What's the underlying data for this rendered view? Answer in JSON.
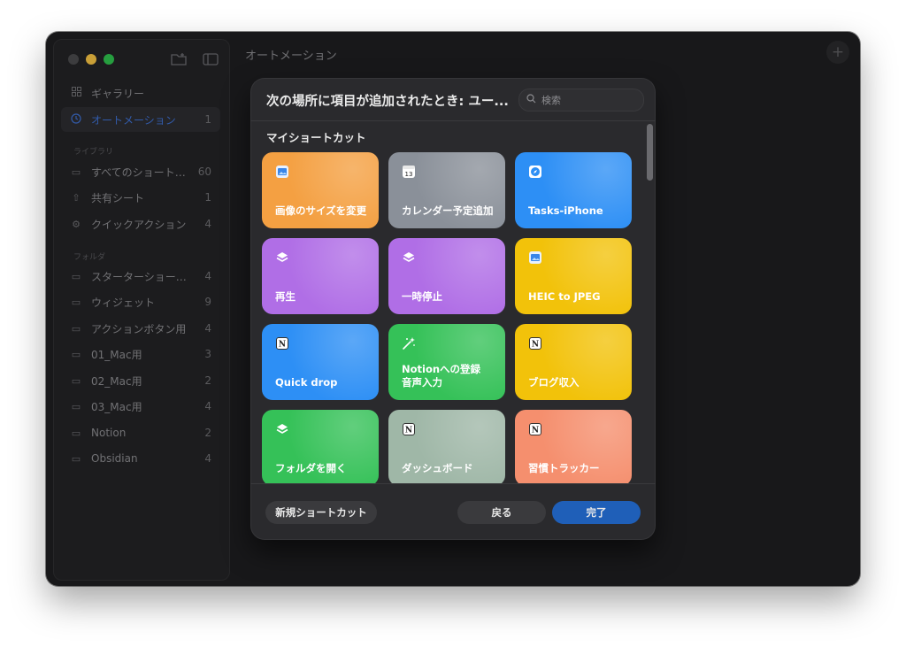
{
  "window": {
    "title": "オートメーション"
  },
  "sidebar": {
    "top_items": [
      {
        "icon": "grid-icon",
        "label": "ギャラリー",
        "count": ""
      },
      {
        "icon": "clock-icon",
        "label": "オートメーション",
        "count": "1"
      }
    ],
    "library_label": "ライブラリ",
    "library_items": [
      {
        "icon": "stack-icon",
        "label": "すべてのショートカ…",
        "count": "60"
      },
      {
        "icon": "share-icon",
        "label": "共有シート",
        "count": "1"
      },
      {
        "icon": "gear-icon",
        "label": "クイックアクション",
        "count": "4"
      }
    ],
    "folders_label": "フォルダ",
    "folder_items": [
      {
        "label": "スターターショートカ…",
        "count": "4"
      },
      {
        "label": "ウィジェット",
        "count": "9"
      },
      {
        "label": "アクションボタン用",
        "count": "4"
      },
      {
        "label": "01_Mac用",
        "count": "3"
      },
      {
        "label": "02_Mac用",
        "count": "2"
      },
      {
        "label": "03_Mac用",
        "count": "4"
      },
      {
        "label": "Notion",
        "count": "2"
      },
      {
        "label": "Obsidian",
        "count": "4"
      }
    ]
  },
  "dialog": {
    "title": "次の場所に項目が追加されたとき: ユー...",
    "search_placeholder": "検索",
    "section_title": "マイショートカット",
    "tiles": [
      {
        "label": "画像のサイズを変更",
        "icon": "preview-app-icon",
        "color": "#f4a042"
      },
      {
        "label": "カレンダー予定追加",
        "icon": "calendar-icon",
        "glyph": "13",
        "color": "#8a9099"
      },
      {
        "label": "Tasks-iPhone",
        "icon": "safari-icon",
        "color": "#2d8ff5"
      },
      {
        "label": "再生",
        "icon": "layers-icon",
        "color": "#b06ee6"
      },
      {
        "label": "一時停止",
        "icon": "layers-icon",
        "color": "#b06ee6"
      },
      {
        "label": "HEIC to JPEG",
        "icon": "preview-app-icon",
        "color": "#f2c20a"
      },
      {
        "label": "Quick drop",
        "icon": "notion-icon",
        "color": "#2d8ff5"
      },
      {
        "label": "Notionへの登録\n音声入力",
        "icon": "sparkle-wand-icon",
        "color": "#35c158"
      },
      {
        "label": "ブログ収入",
        "icon": "notion-icon",
        "color": "#f2c20a"
      },
      {
        "label": "フォルダを開く",
        "icon": "layers-icon",
        "color": "#35c158"
      },
      {
        "label": "ダッシュボード",
        "icon": "notion-icon",
        "color": "#9fb7a7"
      },
      {
        "label": "習慣トラッカー",
        "icon": "notion-icon",
        "color": "#f58f6e"
      }
    ],
    "buttons": {
      "new": "新規ショートカット",
      "back": "戻る",
      "done": "完了"
    }
  },
  "colors": {
    "accent": "#3d6fd0",
    "done_button": "#1f5fb8",
    "window_bg": "#1e1e20"
  }
}
